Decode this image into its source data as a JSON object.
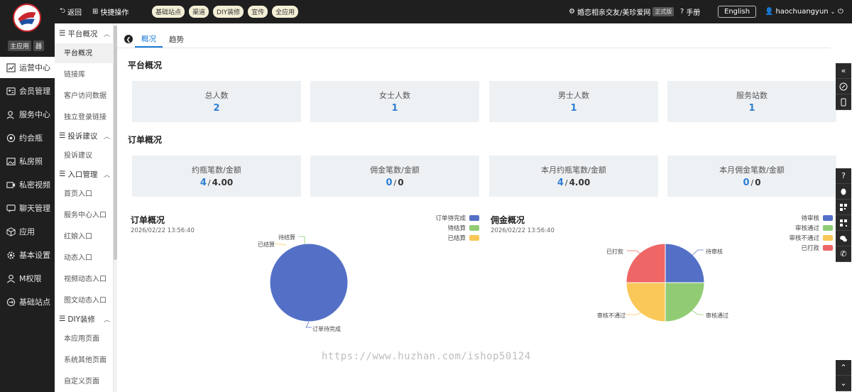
{
  "leftnav": {
    "tags": [
      "主应用",
      "器"
    ],
    "items": [
      {
        "label": "运营中心",
        "icon": "chart-icon",
        "active": true
      },
      {
        "label": "会员管理",
        "icon": "member-icon"
      },
      {
        "label": "服务中心",
        "icon": "service-icon"
      },
      {
        "label": "约会瓶",
        "icon": "bottle-icon"
      },
      {
        "label": "私房照",
        "icon": "photo-icon"
      },
      {
        "label": "私密视频",
        "icon": "video-icon"
      },
      {
        "label": "聊天管理",
        "icon": "chat-icon"
      },
      {
        "label": "应用",
        "icon": "cube-icon"
      },
      {
        "label": "基本设置",
        "icon": "gear-icon"
      },
      {
        "label": "M权限",
        "icon": "user-icon"
      },
      {
        "label": "基础站点",
        "icon": "site-icon"
      }
    ]
  },
  "topbar": {
    "back": "返回",
    "quick": "快捷操作",
    "pills": [
      "基础站点",
      "渠道",
      "DIY装修",
      "宣传",
      "全应用"
    ],
    "site_name": "婚恋相亲交友/美珍爱网",
    "version": "正式版",
    "manual": "手册",
    "language": "English",
    "username": "haochuangyun"
  },
  "subnav": {
    "groups": [
      {
        "title": "平台概况",
        "items": [
          "平台概况",
          "链接库",
          "客户访问数据",
          "独立登录链接"
        ]
      },
      {
        "title": "投诉建议",
        "items": [
          "投诉建议"
        ]
      },
      {
        "title": "入口管理",
        "items": [
          "首页入口",
          "服务中心入口",
          "红娘入口",
          "动态入口",
          "视频动态入口",
          "图文动态入口"
        ]
      },
      {
        "title": "DIY装修",
        "items": [
          "本应用页面",
          "系统其他页面",
          "自定义页面"
        ]
      }
    ]
  },
  "tabs": [
    "概况",
    "趋势"
  ],
  "platform": {
    "title": "平台概况",
    "cards": [
      {
        "label": "总人数",
        "value": "2"
      },
      {
        "label": "女士人数",
        "value": "1"
      },
      {
        "label": "男士人数",
        "value": "1"
      },
      {
        "label": "服务站数",
        "value": "1"
      }
    ]
  },
  "orders": {
    "title": "订单概况",
    "cards": [
      {
        "label": "约瓶笔数/金额",
        "count": "4",
        "sep": "/",
        "amount": "4.00"
      },
      {
        "label": "佣金笔数/金额",
        "count": "0",
        "sep": "/",
        "amount": "0"
      },
      {
        "label": "本月约瓶笔数/金额",
        "count": "4",
        "sep": "/",
        "amount": "4.00"
      },
      {
        "label": "本月佣金笔数/金额",
        "count": "0",
        "sep": "/",
        "amount": "0"
      }
    ]
  },
  "chart_data": [
    {
      "type": "pie",
      "title": "订单概况",
      "subtitle": "2026/02/22 13:56:40",
      "categories": [
        "订单待完成",
        "待结算",
        "已结算"
      ],
      "values": [
        1,
        0,
        0
      ],
      "colors": [
        "#5470c6",
        "#91cc75",
        "#fac858"
      ],
      "legend": "top-right"
    },
    {
      "type": "pie",
      "title": "佣金概况",
      "subtitle": "2026/02/22 13:56:40",
      "categories": [
        "待审核",
        "审核通过",
        "审核不通过",
        "已打款"
      ],
      "values": [
        1,
        1,
        1,
        1
      ],
      "colors": [
        "#5470c6",
        "#91cc75",
        "#fac858",
        "#ee6666"
      ],
      "legend": "top-right"
    }
  ],
  "watermark": "https://www.huzhan.com/ishop50124"
}
